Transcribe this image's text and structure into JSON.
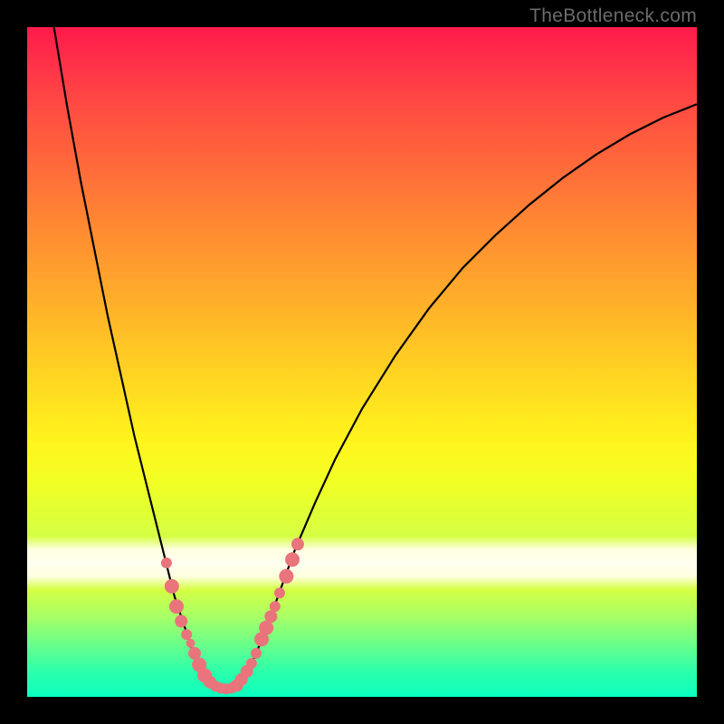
{
  "attribution": "TheBottleneck.com",
  "chart_data": {
    "type": "line",
    "title": "",
    "xlabel": "",
    "ylabel": "",
    "xlim": [
      0,
      100
    ],
    "ylim": [
      0,
      100
    ],
    "grid": false,
    "legend": false,
    "series": [
      {
        "name": "bottleneck-curve",
        "kind": "curve",
        "path": [
          {
            "x": 4.0,
            "y": 100.0
          },
          {
            "x": 6.0,
            "y": 88.0
          },
          {
            "x": 8.0,
            "y": 77.0
          },
          {
            "x": 10.0,
            "y": 67.0
          },
          {
            "x": 12.0,
            "y": 57.0
          },
          {
            "x": 14.0,
            "y": 48.0
          },
          {
            "x": 16.0,
            "y": 39.0
          },
          {
            "x": 18.0,
            "y": 31.0
          },
          {
            "x": 19.0,
            "y": 27.0
          },
          {
            "x": 20.0,
            "y": 23.0
          },
          {
            "x": 21.0,
            "y": 19.0
          },
          {
            "x": 22.0,
            "y": 15.0
          },
          {
            "x": 23.0,
            "y": 12.0
          },
          {
            "x": 24.0,
            "y": 9.0
          },
          {
            "x": 25.0,
            "y": 6.0
          },
          {
            "x": 26.0,
            "y": 4.0
          },
          {
            "x": 27.0,
            "y": 2.5
          },
          {
            "x": 28.0,
            "y": 1.6
          },
          {
            "x": 29.0,
            "y": 1.2
          },
          {
            "x": 30.0,
            "y": 1.2
          },
          {
            "x": 31.0,
            "y": 1.6
          },
          {
            "x": 32.0,
            "y": 2.5
          },
          {
            "x": 33.0,
            "y": 4.0
          },
          {
            "x": 34.0,
            "y": 6.0
          },
          {
            "x": 35.0,
            "y": 8.5
          },
          {
            "x": 36.0,
            "y": 11.0
          },
          {
            "x": 38.0,
            "y": 16.5
          },
          {
            "x": 40.0,
            "y": 22.0
          },
          {
            "x": 43.0,
            "y": 29.0
          },
          {
            "x": 46.0,
            "y": 35.5
          },
          {
            "x": 50.0,
            "y": 43.0
          },
          {
            "x": 55.0,
            "y": 51.0
          },
          {
            "x": 60.0,
            "y": 58.0
          },
          {
            "x": 65.0,
            "y": 64.0
          },
          {
            "x": 70.0,
            "y": 69.0
          },
          {
            "x": 75.0,
            "y": 73.5
          },
          {
            "x": 80.0,
            "y": 77.5
          },
          {
            "x": 85.0,
            "y": 81.0
          },
          {
            "x": 90.0,
            "y": 84.0
          },
          {
            "x": 95.0,
            "y": 86.5
          },
          {
            "x": 100.0,
            "y": 88.5
          }
        ]
      },
      {
        "name": "markers",
        "kind": "scatter",
        "points": [
          {
            "x": 20.8,
            "y": 20.0,
            "r": 6
          },
          {
            "x": 21.6,
            "y": 16.5,
            "r": 8
          },
          {
            "x": 22.3,
            "y": 13.5,
            "r": 8
          },
          {
            "x": 23.0,
            "y": 11.3,
            "r": 7
          },
          {
            "x": 23.8,
            "y": 9.3,
            "r": 6
          },
          {
            "x": 24.4,
            "y": 8.0,
            "r": 5
          },
          {
            "x": 25.0,
            "y": 6.5,
            "r": 7
          },
          {
            "x": 25.7,
            "y": 4.8,
            "r": 8
          },
          {
            "x": 26.5,
            "y": 3.2,
            "r": 8
          },
          {
            "x": 27.3,
            "y": 2.2,
            "r": 7
          },
          {
            "x": 28.1,
            "y": 1.6,
            "r": 6
          },
          {
            "x": 28.9,
            "y": 1.3,
            "r": 6
          },
          {
            "x": 29.7,
            "y": 1.2,
            "r": 6
          },
          {
            "x": 30.5,
            "y": 1.3,
            "r": 6
          },
          {
            "x": 31.3,
            "y": 1.7,
            "r": 7
          },
          {
            "x": 32.0,
            "y": 2.6,
            "r": 7
          },
          {
            "x": 32.8,
            "y": 3.8,
            "r": 7
          },
          {
            "x": 33.5,
            "y": 5.0,
            "r": 6
          },
          {
            "x": 34.2,
            "y": 6.5,
            "r": 6
          },
          {
            "x": 35.0,
            "y": 8.6,
            "r": 8
          },
          {
            "x": 35.7,
            "y": 10.3,
            "r": 8
          },
          {
            "x": 36.4,
            "y": 12.0,
            "r": 7
          },
          {
            "x": 37.0,
            "y": 13.5,
            "r": 6
          },
          {
            "x": 37.7,
            "y": 15.5,
            "r": 6
          },
          {
            "x": 38.7,
            "y": 18.0,
            "r": 8
          },
          {
            "x": 39.6,
            "y": 20.5,
            "r": 8
          },
          {
            "x": 40.4,
            "y": 22.8,
            "r": 7
          }
        ]
      }
    ]
  }
}
